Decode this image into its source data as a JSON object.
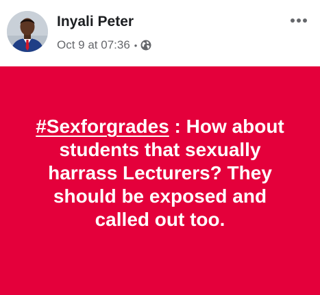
{
  "post": {
    "author": {
      "name": "Inyali Peter",
      "avatar_icon": "profile-photo"
    },
    "meta": {
      "timestamp": "Oct 9 at 07:36",
      "separator": "•",
      "audience_icon": "globe-icon"
    },
    "more_icon": "more-options-icon",
    "body": {
      "hashtag": "#Sexforgrades",
      "text": " : How about students that sexually harrass Lecturers? They should be exposed and called out too."
    },
    "colors": {
      "background_color": "#e4003b",
      "text_color": "#ffffff",
      "name_color": "#1c1e21",
      "meta_color": "#65676b"
    }
  }
}
